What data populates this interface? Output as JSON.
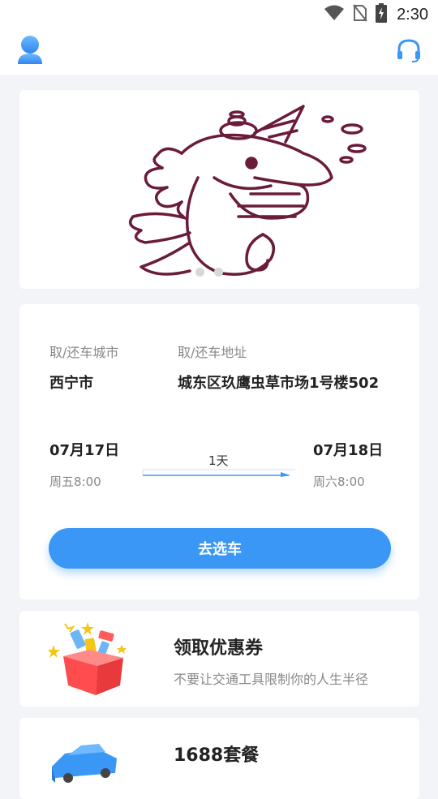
{
  "status_bar": {
    "time": "2:30",
    "icons": [
      "wifi-icon",
      "no-sim-icon",
      "battery-charging-icon"
    ]
  },
  "header": {
    "left_icon": "user-avatar-icon",
    "right_icon": "headset-support-icon"
  },
  "banner": {
    "illustration": "seahorse-unicorn-illustration",
    "dots_count": 2,
    "active_dot": 0
  },
  "booking": {
    "city_label": "取/还车城市",
    "city_value": "西宁市",
    "address_label": "取/还车地址",
    "address_value": "城东区玖鹰虫草市场1号楼502",
    "pickup_date": "07月17日",
    "pickup_time": "周五8:00",
    "return_date": "07月18日",
    "return_time": "周六8:00",
    "duration": "1天",
    "button_label": "去选车"
  },
  "promos": [
    {
      "icon": "gift-box-icon",
      "title": "领取优惠券",
      "subtitle": "不要让交通工具限制你的人生半径"
    },
    {
      "icon": "car-icon",
      "title": "1688套餐",
      "subtitle": ""
    }
  ],
  "colors": {
    "accent": "#3b97f5",
    "background": "#f2f4f8",
    "card": "#ffffff",
    "text_primary": "#222222",
    "text_secondary": "#888888"
  }
}
